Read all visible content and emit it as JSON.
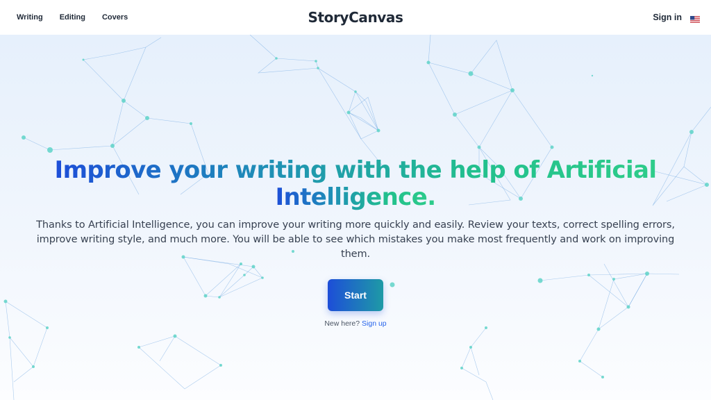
{
  "nav": {
    "links": [
      {
        "label": "Writing"
      },
      {
        "label": "Editing"
      },
      {
        "label": "Covers"
      }
    ],
    "brand": "StoryCanvas",
    "sign_in": "Sign in",
    "language_flag_icon": "us-flag-icon"
  },
  "hero": {
    "headline": "Improve your writing with the help of Artificial Intelligence.",
    "subtitle": "Thanks to Artificial Intelligence, you can improve your writing more quickly and easily. Review your texts, correct spelling errors, improve writing style, and much more. You will be able to see which mistakes you make most frequently and work on improving them.",
    "cta_label": "Start",
    "new_here_text": "New here?",
    "sign_up_label": "Sign up"
  },
  "colors": {
    "gradient_start": "#1d4ed8",
    "gradient_end": "#2ecc8a",
    "link": "#2563eb",
    "network_node": "#5fd3c8",
    "network_line": "#4a90d9"
  }
}
